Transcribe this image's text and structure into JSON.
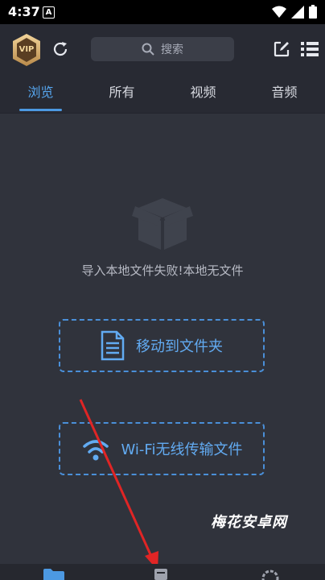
{
  "status_bar": {
    "time": "4:37",
    "notification_letter": "A"
  },
  "header": {
    "vip_label": "VIP",
    "search": {
      "placeholder": "搜索"
    }
  },
  "tabs": [
    {
      "label": "浏览",
      "active": true
    },
    {
      "label": "所有",
      "active": false
    },
    {
      "label": "视频",
      "active": false
    },
    {
      "label": "音频",
      "active": false
    }
  ],
  "main": {
    "empty_message": "导入本地文件失败!本地无文件",
    "move_to_folder_label": "移动到文件夹",
    "wifi_transfer_label": "Wi-Fi无线传输文件"
  },
  "watermark": "梅花安卓网",
  "colors": {
    "accent": "#4c99e2",
    "background": "#30333c",
    "header_bg": "#282a33",
    "annotation_arrow": "#e02525"
  }
}
